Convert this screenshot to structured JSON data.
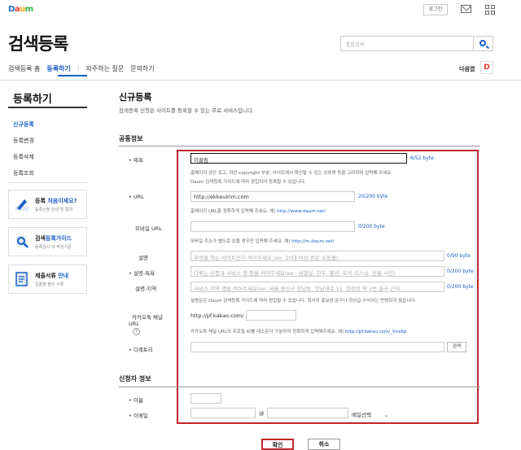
{
  "header": {
    "logo": "Daum",
    "login_label": "로그인",
    "mail_icon": "mail-icon",
    "apps_icon": "grid-icon",
    "page_title": "검색등록",
    "search_placeholder": "통합검색",
    "nav": [
      "검색등록 홈",
      "등록하기",
      "자주하는 질문",
      "문의하기"
    ],
    "nav_active": "등록하기",
    "daum_app_label": "다음앱",
    "daum_app_icon_text": "D"
  },
  "sidebar": {
    "title": "등록하기",
    "items": [
      "신규등록",
      "등록변경",
      "등록삭제",
      "등록조회"
    ],
    "active": "신규등록",
    "promos": [
      {
        "icon": "pen-icon",
        "title_plain": "등록 ",
        "title_accent": "처음이세요?",
        "sub": "등록신청 안내 및 절차"
      },
      {
        "icon": "magnifier-icon",
        "title_plain": "검색",
        "title_accent": "등록가이드",
        "sub": "등록심사 및 작성기준"
      },
      {
        "icon": "document-icon",
        "title_plain": "제출서류 ",
        "title_accent": "안내",
        "sub": "업종별 필수 서류"
      }
    ]
  },
  "main": {
    "title": "신규등록",
    "description": "검색등록 신청은 사이트를 등록할 수 있는 무료 서비스입니다.",
    "section_common": "공통정보",
    "section_applicant": "신청자 정보",
    "fields": {
      "title": {
        "label": "• 제목",
        "value": "이끌림",
        "counter": "6/52 byte",
        "help1": "홈페이지 상단 로고, 하단 copyright 부분, 사이트에서 확인할 수 있는 상호명 등을 고려하여 입력해 주세요.",
        "help2": "Daum 검색등록 가이드에 따라 편집되어 등록될 수 있습니다."
      },
      "url": {
        "label": "• URL",
        "value": "http://ekkeulrim.com",
        "counter": "20/200 byte",
        "help_text": "홈페이지 URL을 정확하게 입력해 주세요. 예) ",
        "help_link": "http://www.daum.net/"
      },
      "mobile_url": {
        "label": "모바일 URL",
        "value": "",
        "counter": "0/200 byte",
        "help_text": "모바일 주소가 별도로 있을 경우만 입력해 주세요. 예) ",
        "help_link": "http://m.daum.net/"
      },
      "desc": {
        "label": "설명",
        "placeholder": "무엇을 하는 사이트인지 적어주세요 (ex: 20대 여성 전문 쇼핑몰)",
        "counter": "0/90 byte"
      },
      "desc_feature": {
        "label": "• 설명-특욕",
        "placeholder": "다루는 상품과 서비스 명 등을 적어주세요(ex : 섬겹살, 한우, 펜션, 토익 리스닝, 인물 사진)",
        "counter": "0/200 byte"
      },
      "desc_region": {
        "label": "설명-지역",
        "placeholder": "서비스 지역 명을 적어주세요(ex: 서울 용산구 한남동, 한남대로 11, 한강진 역 1번 출구 근처",
        "counter": "0/200 byte",
        "help": "설명문은 Daum 검색등록 가이드에 따라 편집될 수 있습니다. 회사의 홍보성 문구나 최상급 수식어는 반영되지 않습니다."
      },
      "kakao": {
        "label1": "카카오톡 채널",
        "label2": "URL",
        "help_icon": "?",
        "prefix": "http://pf.kakao.com/",
        "value": "",
        "help_text": "카카오톡 채널 URL의 프로필 ID를 대소문자 구분하여 정확하게 입력해주세요. 예) ",
        "help_link": "http://pf.kakao.com/_Vnxfql"
      },
      "directory": {
        "label": "• 디렉토리",
        "value": "",
        "button": "검색"
      },
      "name": {
        "label": "• 이름",
        "value": ""
      },
      "email": {
        "label": "• 이메일",
        "at": "@",
        "select": "메일선택",
        "select_arrow": "⌄"
      }
    },
    "buttons": {
      "ok": "확인",
      "cancel": "취소"
    }
  },
  "colors": {
    "accent": "#1a5fc7",
    "highlight_red": "#c0272d"
  }
}
